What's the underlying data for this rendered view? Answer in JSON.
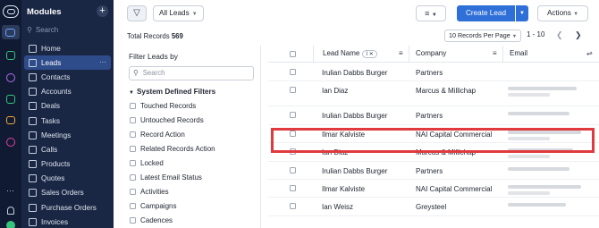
{
  "sidebar": {
    "title": "Modules",
    "add_symbol": "+",
    "search_placeholder": "Search",
    "more_symbol": "···",
    "items": [
      {
        "label": "Home",
        "icon": "home-icon",
        "active": false
      },
      {
        "label": "Leads",
        "icon": "leads-icon",
        "active": true
      },
      {
        "label": "Contacts",
        "icon": "contacts-icon",
        "active": false
      },
      {
        "label": "Accounts",
        "icon": "accounts-icon",
        "active": false
      },
      {
        "label": "Deals",
        "icon": "deals-icon",
        "active": false
      },
      {
        "label": "Tasks",
        "icon": "tasks-icon",
        "active": false
      },
      {
        "label": "Meetings",
        "icon": "meetings-icon",
        "active": false
      },
      {
        "label": "Calls",
        "icon": "calls-icon",
        "active": false
      },
      {
        "label": "Products",
        "icon": "products-icon",
        "active": false
      },
      {
        "label": "Quotes",
        "icon": "quotes-icon",
        "active": false
      },
      {
        "label": "Sales Orders",
        "icon": "sales-orders-icon",
        "active": false
      },
      {
        "label": "Purchase Orders",
        "icon": "purchase-orders-icon",
        "active": false
      },
      {
        "label": "Invoices",
        "icon": "invoices-icon",
        "active": false
      }
    ]
  },
  "toolbar": {
    "filter_icon": "filter-icon",
    "view_label": "All Leads",
    "create_label": "Create Lead",
    "actions_label": "Actions"
  },
  "summary": {
    "total_label": "Total Records",
    "total_count": "569",
    "per_page": "10 Records Per Page",
    "range": "1 - 10"
  },
  "filter_panel": {
    "title": "Filter Leads by",
    "search_placeholder": "Search",
    "section_title": "System Defined Filters",
    "items": [
      "Touched Records",
      "Untouched Records",
      "Record Action",
      "Related Records Action",
      "Locked",
      "Latest Email Status",
      "Activities",
      "Campaigns",
      "Cadences"
    ]
  },
  "table": {
    "columns": {
      "lead_name": "Lead Name",
      "company": "Company",
      "email": "Email"
    },
    "rows": [
      {
        "lead_name": "Irulian Dabbs Burger",
        "company": "Partners",
        "highlighted": false
      },
      {
        "lead_name": "Ian Diaz",
        "company": "Marcus & Millichap",
        "highlighted": true
      },
      {
        "lead_name": "Irulian Dabbs Burger",
        "company": "Partners",
        "highlighted": false
      },
      {
        "lead_name": "Ilmar Kalviste",
        "company": "NAI Capital Commercial",
        "highlighted": false
      },
      {
        "lead_name": "Ian Diaz",
        "company": "Marcus & Millichap",
        "highlighted": false
      },
      {
        "lead_name": "Irulian Dabbs Burger",
        "company": "Partners",
        "highlighted": false
      },
      {
        "lead_name": "Ilmar Kalviste",
        "company": "NAI Capital Commercial",
        "highlighted": false
      },
      {
        "lead_name": "Ian Weisz",
        "company": "Greysteel",
        "highlighted": false
      }
    ]
  },
  "colors": {
    "rail": "#101b33",
    "sidebar": "#1a2744",
    "active_item": "#2f4c8a",
    "primary_button": "#2f6fd8",
    "highlight_border": "#e0393e"
  }
}
